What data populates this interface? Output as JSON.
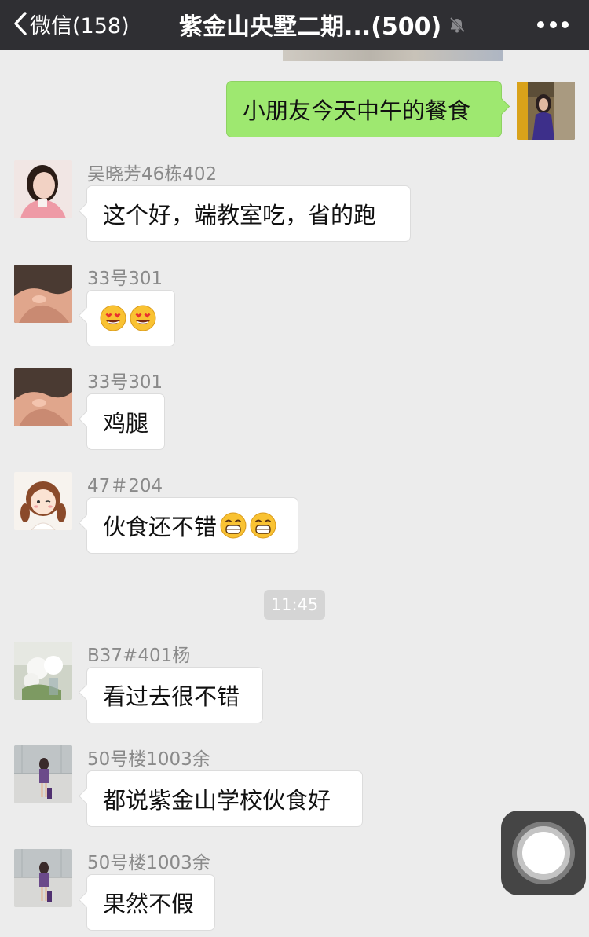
{
  "navbar": {
    "back_label": "微信(158)",
    "title": "紫金山央墅二期...(500)"
  },
  "messages": [
    {
      "sender": "",
      "text": "小朋友今天中午的餐食",
      "outgoing": true
    },
    {
      "sender": "吴晓芳46栋402",
      "text": "这个好，端教室吃，省的跑"
    },
    {
      "sender": "33号301",
      "text": "",
      "emoji": [
        "heart-eyes-emoji",
        "heart-eyes-emoji"
      ]
    },
    {
      "sender": "33号301",
      "text": "鸡腿"
    },
    {
      "sender": "47＃204",
      "text": "伙食还不错",
      "emoji": [
        "grin-emoji",
        "grin-emoji"
      ]
    },
    {
      "sender": "B37#401杨",
      "text": "看过去很不错"
    },
    {
      "sender": "50号楼1003余",
      "text": "都说紫金山学校伙食好"
    },
    {
      "sender": "50号楼1003余",
      "text": "果然不假"
    }
  ],
  "timestamp": "11:45",
  "colors": {
    "navbar_bg": "#2f2f33",
    "chat_bg": "#ececec",
    "outgoing_bubble": "#9ee870",
    "incoming_bubble": "#ffffff"
  }
}
